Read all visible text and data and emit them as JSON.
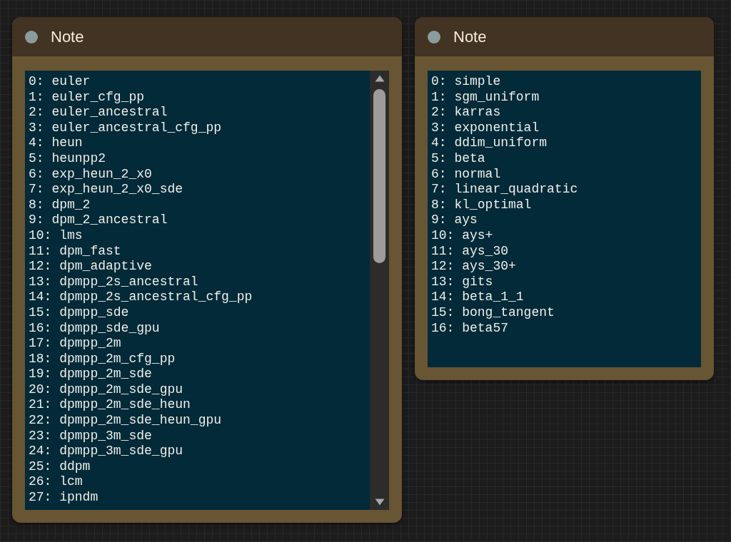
{
  "nodes": [
    {
      "title": "Note",
      "scrollbar": true,
      "text_lines": [
        "0: euler",
        "1: euler_cfg_pp",
        "2: euler_ancestral",
        "3: euler_ancestral_cfg_pp",
        "4: heun",
        "5: heunpp2",
        "6: exp_heun_2_x0",
        "7: exp_heun_2_x0_sde",
        "8: dpm_2",
        "9: dpm_2_ancestral",
        "10: lms",
        "11: dpm_fast",
        "12: dpm_adaptive",
        "13: dpmpp_2s_ancestral",
        "14: dpmpp_2s_ancestral_cfg_pp",
        "15: dpmpp_sde",
        "16: dpmpp_sde_gpu",
        "17: dpmpp_2m",
        "18: dpmpp_2m_cfg_pp",
        "19: dpmpp_2m_sde",
        "20: dpmpp_2m_sde_gpu",
        "21: dpmpp_2m_sde_heun",
        "22: dpmpp_2m_sde_heun_gpu",
        "23: dpmpp_3m_sde",
        "24: dpmpp_3m_sde_gpu",
        "25: ddpm",
        "26: lcm",
        "27: ipndm"
      ]
    },
    {
      "title": "Note",
      "scrollbar": false,
      "text_lines": [
        "0: simple",
        "1: sgm_uniform",
        "2: karras",
        "3: exponential",
        "4: ddim_uniform",
        "5: beta",
        "6: normal",
        "7: linear_quadratic",
        "8: kl_optimal",
        "9: ays",
        "10: ays+",
        "11: ays_30",
        "12: ays_30+",
        "13: gits",
        "14: beta_1_1",
        "15: bong_tangent",
        "16: beta57"
      ]
    }
  ]
}
